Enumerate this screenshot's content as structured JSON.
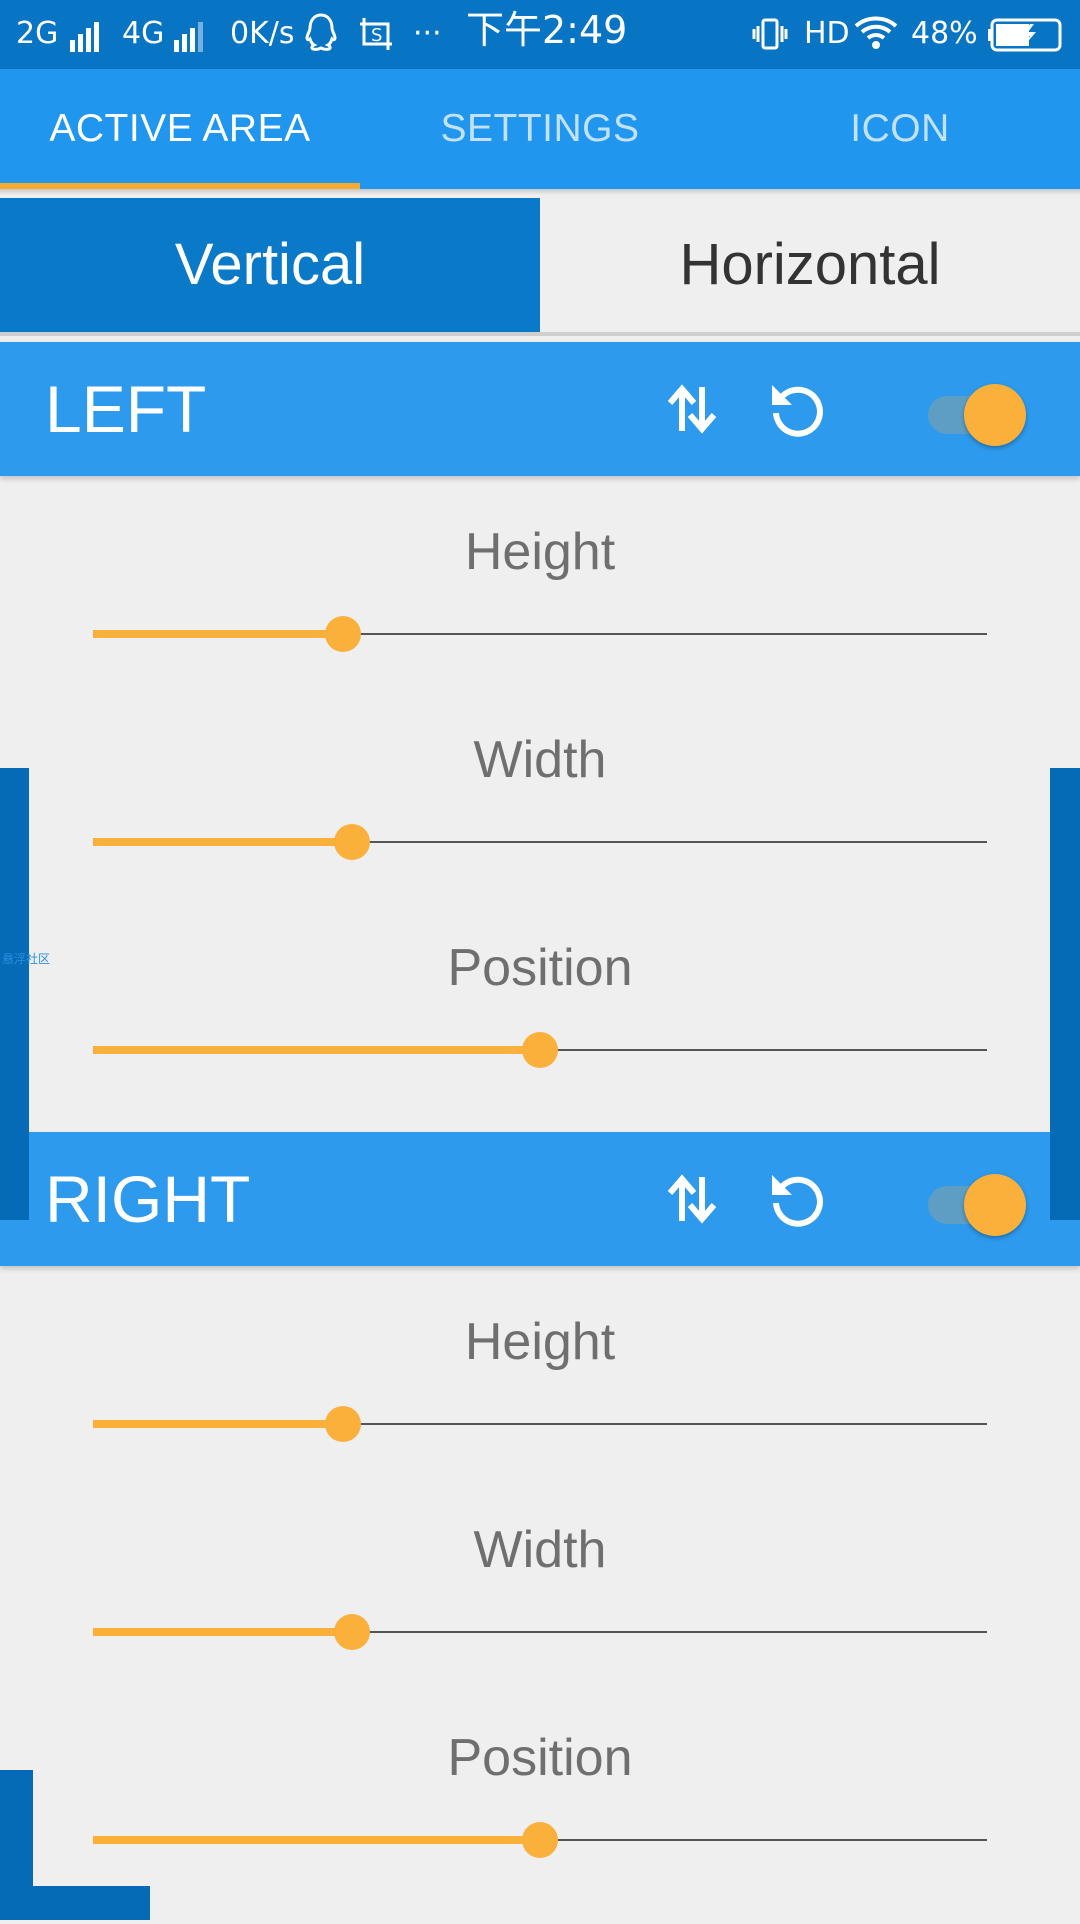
{
  "status_bar": {
    "network1": "2G",
    "network2": "4G",
    "speed": "0K/s",
    "dots": "···",
    "time": "下午2:49",
    "hd": "HD",
    "battery": "48%"
  },
  "tabs": [
    {
      "label": "ACTIVE AREA",
      "active": true
    },
    {
      "label": "SETTINGS",
      "active": false
    },
    {
      "label": "ICON",
      "active": false
    }
  ],
  "orientation": {
    "options": [
      "Vertical",
      "Horizontal"
    ],
    "selected": "Vertical"
  },
  "sections": [
    {
      "title": "LEFT",
      "enabled": true,
      "sliders": [
        {
          "label": "Height",
          "value": 0.28
        },
        {
          "label": "Width",
          "value": 0.29
        },
        {
          "label": "Position",
          "value": 0.5
        }
      ]
    },
    {
      "title": "RIGHT",
      "enabled": true,
      "sliders": [
        {
          "label": "Height",
          "value": 0.28
        },
        {
          "label": "Width",
          "value": 0.29
        },
        {
          "label": "Position",
          "value": 0.5
        }
      ]
    }
  ],
  "overlay_label": "悬浮社区",
  "colors": {
    "status_bar": "#0874c4",
    "tab_bar": "#2196ee",
    "accent": "#fbb03b",
    "section_header": "#2d9aed",
    "overlay": "#066bb6"
  }
}
